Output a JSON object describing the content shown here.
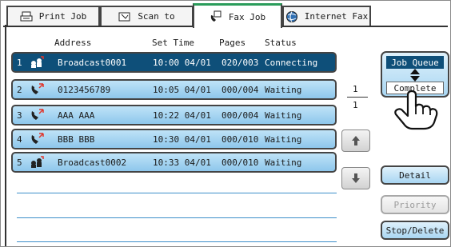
{
  "tabs": [
    {
      "label": "Print Job",
      "icon": "printer-icon"
    },
    {
      "label": "Scan to",
      "icon": "scanner-icon"
    },
    {
      "label": "Fax Job",
      "icon": "fax-icon",
      "active": true
    },
    {
      "label": "Internet Fax",
      "icon": "globe-icon"
    }
  ],
  "columns": {
    "address": "Address",
    "set_time": "Set Time",
    "pages": "Pages",
    "status": "Status"
  },
  "jobs": [
    {
      "num": "1",
      "icon": "broadcast-icon",
      "address": "Broadcast0001",
      "set_time": "10:00 04/01",
      "pages": "020/003",
      "status": "Connecting",
      "selected": true
    },
    {
      "num": "2",
      "icon": "phone-icon",
      "address": "0123456789",
      "set_time": "10:05 04/01",
      "pages": "000/004",
      "status": "Waiting"
    },
    {
      "num": "3",
      "icon": "phone-icon",
      "address": "AAA AAA",
      "set_time": "10:22 04/01",
      "pages": "000/004",
      "status": "Waiting"
    },
    {
      "num": "4",
      "icon": "phone-icon",
      "address": "BBB BBB",
      "set_time": "10:30 04/01",
      "pages": "000/010",
      "status": "Waiting"
    },
    {
      "num": "5",
      "icon": "broadcast-icon",
      "address": "Broadcast0002",
      "set_time": "10:33 04/01",
      "pages": "000/010",
      "status": "Waiting"
    }
  ],
  "pager": {
    "current": "1",
    "total": "1"
  },
  "queue_toggle": {
    "job_queue": "Job Queue",
    "complete": "Complete",
    "selected": "Job Queue"
  },
  "buttons": {
    "detail": "Detail",
    "priority": "Priority",
    "stop_delete": "Stop/Delete"
  },
  "colors": {
    "row_fill": "#a6d5f1",
    "row_selected": "#0e4f79",
    "active_tab_accent": "#2a9c5a"
  }
}
